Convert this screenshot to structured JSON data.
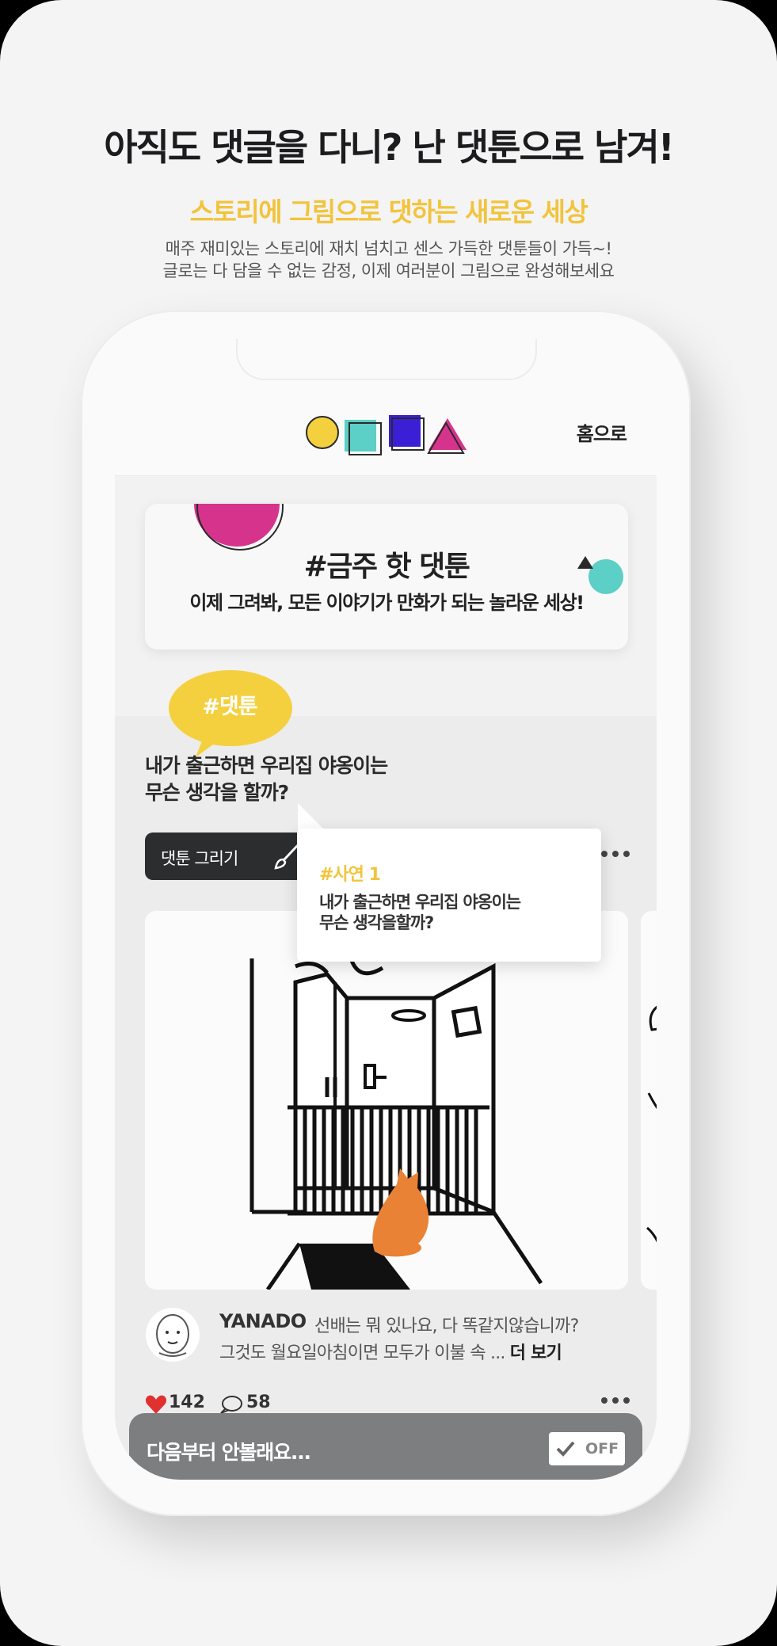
{
  "hero": {
    "headline": "아직도 댓글을 다니? 난 댓툰으로 남겨!",
    "subheadline": "스토리에 그림으로 댓하는 새로운 세상",
    "intro_line1": "매주 재미있는 스토리에 재치 넘치고 센스 가득한 댓툰들이 가득~!",
    "intro_line2": "글로는 다 담을 수 없는 감정, 이제 여러분이 그림으로 완성해보세요"
  },
  "app": {
    "home_link": "홈으로",
    "banner": {
      "title": "#금주 핫 댓툰",
      "subtitle": "이제 그려봐, 모든 이야기가 만화가 되는 놀라운 세상!"
    },
    "feed": {
      "bubble_label": "#댓툰",
      "question_line1": "내가 출근하면 우리집 야옹이는",
      "question_line2": "무슨 생각을 할까?",
      "draw_button": "댓툰 그리기",
      "popup": {
        "tag": "#사연 1",
        "line1": "내가 출근하면 우리집 야옹이는",
        "line2": "무슨 생각을할까?"
      },
      "comment": {
        "user": "YANADO",
        "text": "선배는 뭐 있나요, 다 똑같지않습니까?",
        "text_line2": "그것도 월요일아침이면 모두가 이불 속 ... ",
        "more": "더 보기"
      },
      "likes": "142",
      "comments": "58"
    },
    "bottom_bar": {
      "text": "다음부터 안볼래요...",
      "toggle": "OFF"
    }
  },
  "colors": {
    "accent_yellow": "#f2c43c",
    "magenta": "#d6348c",
    "teal": "#5ccfc6",
    "purple": "#3b1fd6",
    "cat_orange": "#e98235"
  }
}
